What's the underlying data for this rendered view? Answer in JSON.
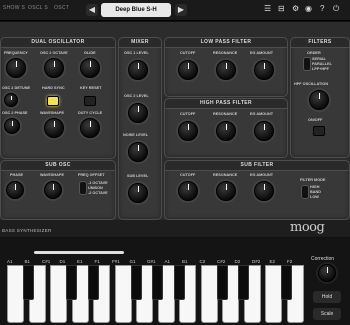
{
  "topbar": {
    "tabs": [
      "SHOW S",
      "OSCL S",
      "OSCT"
    ],
    "preset_name": "Deep Blue S-H",
    "prev_label": "◀",
    "next_label": "▶"
  },
  "oscillator": {
    "title": "DUAL OSCILLATOR",
    "labels": {
      "frequency": "FREQUENCY",
      "osc2_octave": "OSC 2 OCTAVE",
      "glide": "GLIDE",
      "osc2_detune": "OSC 2 DETUNE",
      "hard_sync": "HARD SYNC",
      "key_reset": "KEY RESET",
      "osc2_phase": "OSC 2 PHASE",
      "waveshape": "WAVESHAPE",
      "duty_cycle": "DUTY CYCLE"
    }
  },
  "sub_osc": {
    "title": "SUB OSC",
    "labels": {
      "phase": "PHASE",
      "waveshape": "WAVESHAPE",
      "freq_offset": "FREQ OFFSET",
      "opt1": "-1 OCTAVE",
      "opt2": "UNISON",
      "opt3": "-2 OCTAVE"
    }
  },
  "mixer": {
    "title": "MIXER",
    "labels": {
      "osc1_level": "OSC 1 LEVEL",
      "osc2_level": "OSC 2 LEVEL",
      "noise_level": "NOISE LEVEL",
      "sub_level": "SUB LEVEL"
    }
  },
  "lpf": {
    "title": "LOW PASS FILTER",
    "labels": {
      "cutoff": "CUTOFF",
      "resonance": "RESONANCE",
      "eg_amount": "EG AMOUNT"
    }
  },
  "hpf": {
    "title": "HIGH PASS FILTER",
    "labels": {
      "cutoff": "CUTOFF",
      "resonance": "RESONANCE",
      "eg_amount": "EG AMOUNT"
    }
  },
  "filters": {
    "title": "FILTERS",
    "labels": {
      "order": "ORDER",
      "serial": "SERIAL",
      "parallel": "PARALLEL",
      "lpf_hpf": "LPF+HPF",
      "hpf_osc": "HPF OSCILLATION",
      "on_off": "ON/OFF"
    }
  },
  "sub_filter": {
    "title": "SUB FILTER",
    "labels": {
      "cutoff": "CUTOFF",
      "resonance": "RESONANCE",
      "eg_amount": "EG AMOUNT",
      "filter_mode": "FILTER MODE",
      "high": "HIGH",
      "band": "BAND",
      "low": "LOW"
    }
  },
  "branding": {
    "synth_label": "BASS SYNTHESIZER",
    "logo": "moog"
  },
  "keyboard": {
    "notes": [
      "A1",
      "B1",
      "C#1",
      "D1",
      "E1",
      "F1",
      "F#1",
      "G1",
      "G#1",
      "A1",
      "B1",
      "C2",
      "C#2",
      "D2",
      "D#2",
      "E2",
      "F2"
    ]
  },
  "side": {
    "correction_label": "Correction",
    "hold_label": "Hold",
    "scale_label": "Scale"
  }
}
